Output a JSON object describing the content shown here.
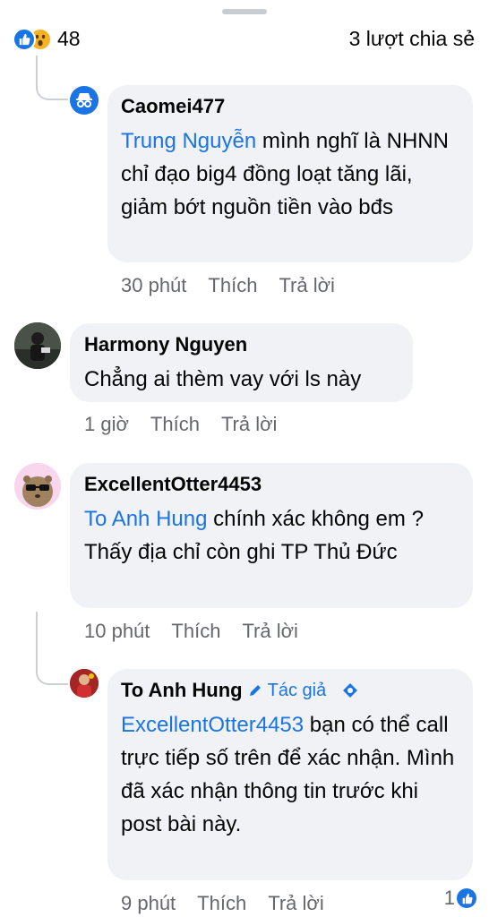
{
  "header": {
    "reaction_count": "48",
    "shares": "3 lượt chia sẻ"
  },
  "comments": [
    {
      "name": "Caomei477",
      "mention": "Trung Nguyễn",
      "text": " mình nghĩ là NHNN chỉ đạo big4 đồng loạt tăng lãi, giảm bớt nguồn tiền vào bđs",
      "time": "30 phút",
      "like": "Thích",
      "reply": "Trả lời"
    },
    {
      "name": "Harmony Nguyen",
      "text": "Chẳng ai thèm vay với ls này",
      "time": "1 giờ",
      "like": "Thích",
      "reply": "Trả lời"
    },
    {
      "name": "ExcellentOtter4453",
      "mention": "To Anh Hung",
      "text": " chính xác không em ? Thấy địa chỉ còn ghi TP Thủ Đức",
      "time": "10 phút",
      "like": "Thích",
      "reply": "Trả lời"
    },
    {
      "name": "To Anh Hung",
      "badge": "Tác giả",
      "mention": "ExcellentOtter4453",
      "text": " bạn có thể call trực tiếp số trên để xác nhận. Mình đã xác nhận thông tin trước khi post bài này.",
      "time": "9 phút",
      "like": "Thích",
      "reply": "Trả lời",
      "reactions": "1"
    }
  ],
  "colors": {
    "accent": "#1b74e4",
    "bubble": "#f0f2f5",
    "meta": "#65676b"
  }
}
